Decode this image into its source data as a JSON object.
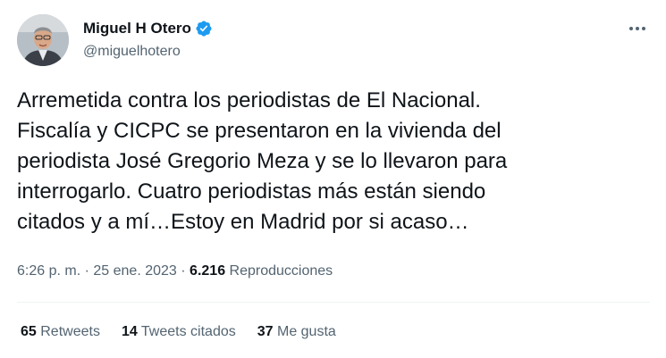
{
  "author": {
    "display_name": "Miguel H Otero",
    "handle": "@miguelhotero",
    "verified": true,
    "avatar_icon": "profile-photo"
  },
  "tweet": {
    "text": "Arremetida contra los periodistas de El Nacional.\nFiscalía y CICPC se presentaron en la vivienda del\nperiodista José Gregorio Meza y se lo llevaron para\ninterrogarlo. Cuatro periodistas más están siendo\ncitados y a mí…Estoy en Madrid por si acaso…"
  },
  "meta": {
    "time": "6:26 p. m.",
    "separator": "·",
    "date": "25 ene. 2023",
    "views_count": "6.216",
    "views_label": "Reproducciones"
  },
  "stats": {
    "retweets_count": "65",
    "retweets_label": "Retweets",
    "quotes_count": "14",
    "quotes_label": "Tweets citados",
    "likes_count": "37",
    "likes_label": "Me gusta"
  },
  "colors": {
    "verified": "#1d9bf0",
    "secondary_text": "#536471",
    "primary_text": "#0f1419",
    "divider": "#eff3f4"
  }
}
